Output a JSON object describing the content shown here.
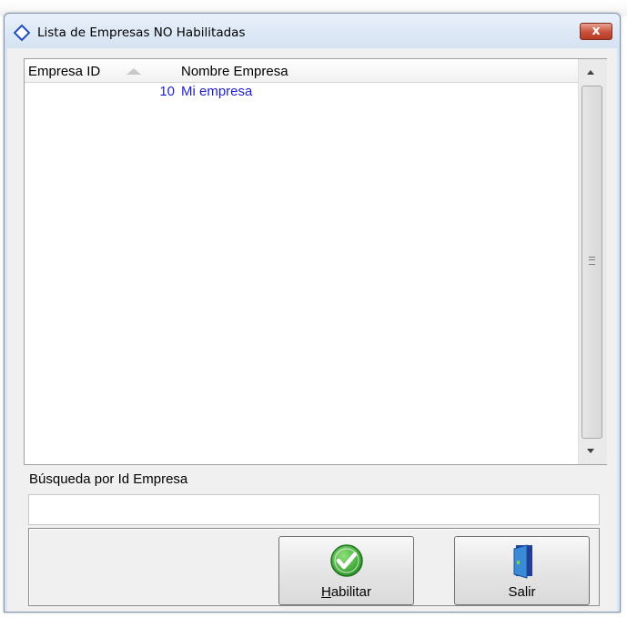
{
  "window": {
    "title": "Lista de Empresas NO Habilitadas",
    "close_label": "x"
  },
  "grid": {
    "columns": [
      "Empresa ID",
      "Nombre Empresa"
    ],
    "sort_indicator": "ascending",
    "rows": [
      {
        "id": "10",
        "name": "Mi empresa"
      }
    ]
  },
  "search": {
    "label": "Búsqueda por Id Empresa",
    "value": "",
    "placeholder": ""
  },
  "buttons": {
    "habilitar": {
      "mnemonic": "H",
      "rest": "abilitar",
      "icon": "green-check-icon"
    },
    "salir": {
      "label": "Salir",
      "icon": "exit-door-icon"
    }
  },
  "colors": {
    "title_bg": "#dde8f6",
    "close_bg": "#c9503a",
    "row_text": "#1f1fd0",
    "client_bg": "#f0f0f0"
  }
}
